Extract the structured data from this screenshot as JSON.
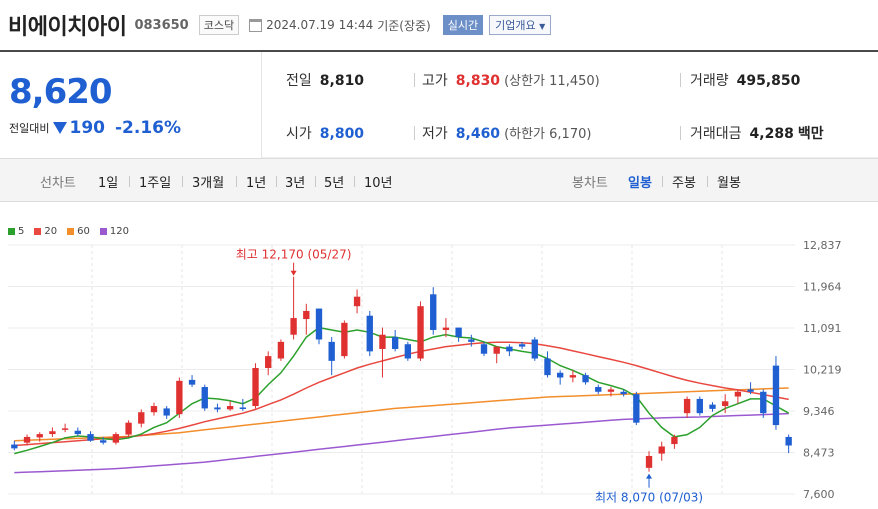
{
  "header": {
    "name": "비에이치아이",
    "code": "083650",
    "market": "코스닥",
    "datetime": "2024.07.19 14:44",
    "basis": "기준(장중)",
    "realtime_label": "실시간",
    "corp_overview_label": "기업개요"
  },
  "price": {
    "current": "8,620",
    "change_label": "전일대비",
    "change_amount": "190",
    "change_percent": "-2.16%"
  },
  "quote": {
    "prev_close_label": "전일",
    "prev_close": "8,810",
    "high_label": "고가",
    "high": "8,830",
    "upper_limit_label": "(상한가 11,450)",
    "volume_label": "거래량",
    "volume": "495,850",
    "open_label": "시가",
    "open": "8,800",
    "low_label": "저가",
    "low": "8,460",
    "lower_limit_label": "(하한가 6,170)",
    "trade_value_label": "거래대금",
    "trade_value": "4,288",
    "trade_value_unit": "백만"
  },
  "toolbar": {
    "line_chart_label": "선차트",
    "periods": [
      "1일",
      "1주일",
      "3개월",
      "1년",
      "3년",
      "5년",
      "10년"
    ],
    "candle_label": "봉차트",
    "candle_periods": [
      "일봉",
      "주봉",
      "월봉"
    ],
    "candle_active": "일봉"
  },
  "colors": {
    "up": "#e03131",
    "down": "#1f5fd1",
    "ma5": "#2ca02c",
    "ma20": "#e8483f",
    "ma60": "#f28e2b",
    "ma120": "#9b59d0"
  },
  "chart_data": {
    "type": "candlestick",
    "legend": [
      {
        "label": "5",
        "color": "#2ca02c"
      },
      {
        "label": "20",
        "color": "#e8483f"
      },
      {
        "label": "60",
        "color": "#f28e2b"
      },
      {
        "label": "120",
        "color": "#9b59d0"
      }
    ],
    "yticks": [
      "12,837",
      "11,964",
      "11,091",
      "10,219",
      "9,346",
      "8,473",
      "7,600"
    ],
    "ylim": [
      7600,
      12837
    ],
    "annotations": {
      "high": {
        "label": "최고 12,170 (05/27)",
        "value": 12170
      },
      "low": {
        "label": "최저 8,070 (07/03)",
        "value": 8070
      }
    },
    "candles": [
      [
        8640,
        8720,
        8520,
        8560
      ],
      [
        8680,
        8850,
        8620,
        8800
      ],
      [
        8790,
        8900,
        8700,
        8860
      ],
      [
        8860,
        9000,
        8800,
        8920
      ],
      [
        8950,
        9080,
        8900,
        8980
      ],
      [
        8930,
        9000,
        8820,
        8860
      ],
      [
        8860,
        8920,
        8700,
        8720
      ],
      [
        8730,
        8800,
        8640,
        8680
      ],
      [
        8680,
        8900,
        8640,
        8860
      ],
      [
        8850,
        9150,
        8800,
        9100
      ],
      [
        9080,
        9380,
        9000,
        9320
      ],
      [
        9320,
        9520,
        9250,
        9450
      ],
      [
        9400,
        9450,
        9180,
        9250
      ],
      [
        9280,
        10050,
        9200,
        9980
      ],
      [
        10000,
        10100,
        9850,
        9900
      ],
      [
        9850,
        9900,
        9350,
        9400
      ],
      [
        9420,
        9500,
        9320,
        9380
      ],
      [
        9380,
        9550,
        9350,
        9450
      ],
      [
        9420,
        9600,
        9350,
        9400
      ],
      [
        9450,
        10350,
        9400,
        10250
      ],
      [
        10250,
        10600,
        10100,
        10500
      ],
      [
        10450,
        10850,
        10400,
        10800
      ],
      [
        10950,
        12170,
        10850,
        11300
      ],
      [
        11280,
        11600,
        10950,
        11450
      ],
      [
        11500,
        11500,
        10750,
        10850
      ],
      [
        10800,
        10900,
        10100,
        10400
      ],
      [
        10500,
        11250,
        10450,
        11200
      ],
      [
        11550,
        11900,
        11400,
        11750
      ],
      [
        11350,
        11450,
        10500,
        10600
      ],
      [
        10650,
        11100,
        10050,
        10950
      ],
      [
        10900,
        11050,
        10600,
        10650
      ],
      [
        10750,
        10800,
        10400,
        10450
      ],
      [
        10450,
        11650,
        10400,
        11550
      ],
      [
        11800,
        11950,
        10950,
        11050
      ],
      [
        11050,
        11300,
        10900,
        11100
      ],
      [
        11100,
        11100,
        10800,
        10900
      ],
      [
        10850,
        10950,
        10700,
        10800
      ],
      [
        10750,
        10800,
        10500,
        10550
      ],
      [
        10550,
        10700,
        10350,
        10700
      ],
      [
        10700,
        10750,
        10500,
        10600
      ],
      [
        10750,
        10800,
        10650,
        10700
      ],
      [
        10850,
        10900,
        10400,
        10450
      ],
      [
        10450,
        10600,
        10050,
        10100
      ],
      [
        10150,
        10200,
        9900,
        10050
      ],
      [
        10050,
        10200,
        9950,
        10100
      ],
      [
        10100,
        10150,
        9900,
        9950
      ],
      [
        9850,
        9900,
        9700,
        9750
      ],
      [
        9750,
        9850,
        9650,
        9800
      ],
      [
        9750,
        9800,
        9650,
        9700
      ],
      [
        9700,
        9750,
        9050,
        9100
      ],
      [
        8150,
        8500,
        8070,
        8400
      ],
      [
        8450,
        8700,
        8300,
        8600
      ],
      [
        8650,
        8850,
        8550,
        8800
      ],
      [
        9300,
        9650,
        9200,
        9600
      ],
      [
        9600,
        9650,
        9250,
        9300
      ],
      [
        9480,
        9530,
        9330,
        9390
      ],
      [
        9450,
        9700,
        9300,
        9550
      ],
      [
        9650,
        9800,
        9500,
        9750
      ],
      [
        9800,
        9950,
        9700,
        9750
      ],
      [
        9750,
        9800,
        9200,
        9300
      ],
      [
        10300,
        10500,
        8950,
        9050
      ],
      [
        8800,
        8850,
        8460,
        8620
      ]
    ],
    "ma5": [
      8450,
      8520,
      8600,
      8680,
      8780,
      8820,
      8800,
      8760,
      8740,
      8780,
      8860,
      9000,
      9100,
      9300,
      9500,
      9620,
      9600,
      9560,
      9500,
      9620,
      9900,
      10150,
      10500,
      10900,
      11100,
      11050,
      11000,
      11050,
      11000,
      10900,
      10900,
      10850,
      10800,
      10900,
      10950,
      10900,
      10880,
      10800,
      10700,
      10650,
      10600,
      10560,
      10450,
      10300,
      10200,
      10080,
      9950,
      9880,
      9800,
      9650,
      9300,
      9000,
      8800,
      8850,
      9000,
      9250,
      9400,
      9500,
      9600,
      9600,
      9450,
      9300
    ],
    "ma20": [
      8620,
      8640,
      8660,
      8680,
      8700,
      8720,
      8740,
      8760,
      8780,
      8800,
      8830,
      8870,
      8920,
      8980,
      9050,
      9120,
      9180,
      9240,
      9300,
      9380,
      9480,
      9580,
      9700,
      9830,
      9950,
      10050,
      10150,
      10250,
      10330,
      10400,
      10470,
      10540,
      10600,
      10650,
      10700,
      10730,
      10760,
      10780,
      10790,
      10790,
      10780,
      10760,
      10720,
      10670,
      10610,
      10550,
      10490,
      10430,
      10370,
      10300,
      10220,
      10140,
      10060,
      9990,
      9930,
      9880,
      9830,
      9790,
      9740,
      9690,
      9640,
      9590
    ],
    "ma60": [
      8720,
      8730,
      8740,
      8750,
      8760,
      8770,
      8780,
      8790,
      8800,
      8810,
      8830,
      8850,
      8870,
      8890,
      8920,
      8950,
      8980,
      9010,
      9040,
      9070,
      9100,
      9130,
      9160,
      9190,
      9220,
      9250,
      9280,
      9310,
      9340,
      9370,
      9400,
      9420,
      9440,
      9460,
      9480,
      9500,
      9520,
      9540,
      9560,
      9580,
      9600,
      9620,
      9640,
      9650,
      9660,
      9670,
      9680,
      9690,
      9700,
      9710,
      9720,
      9730,
      9740,
      9750,
      9760,
      9770,
      9780,
      9790,
      9800,
      9810,
      9820,
      9830
    ],
    "ma120": [
      8050,
      8060,
      8070,
      8080,
      8090,
      8100,
      8110,
      8120,
      8135,
      8150,
      8170,
      8190,
      8210,
      8230,
      8250,
      8270,
      8300,
      8330,
      8360,
      8390,
      8420,
      8450,
      8480,
      8510,
      8540,
      8570,
      8600,
      8630,
      8660,
      8690,
      8720,
      8750,
      8780,
      8810,
      8840,
      8870,
      8900,
      8930,
      8960,
      8990,
      9010,
      9030,
      9050,
      9070,
      9090,
      9110,
      9130,
      9150,
      9170,
      9180,
      9190,
      9200,
      9210,
      9215,
      9220,
      9230,
      9240,
      9250,
      9260,
      9270,
      9280,
      9290
    ]
  }
}
